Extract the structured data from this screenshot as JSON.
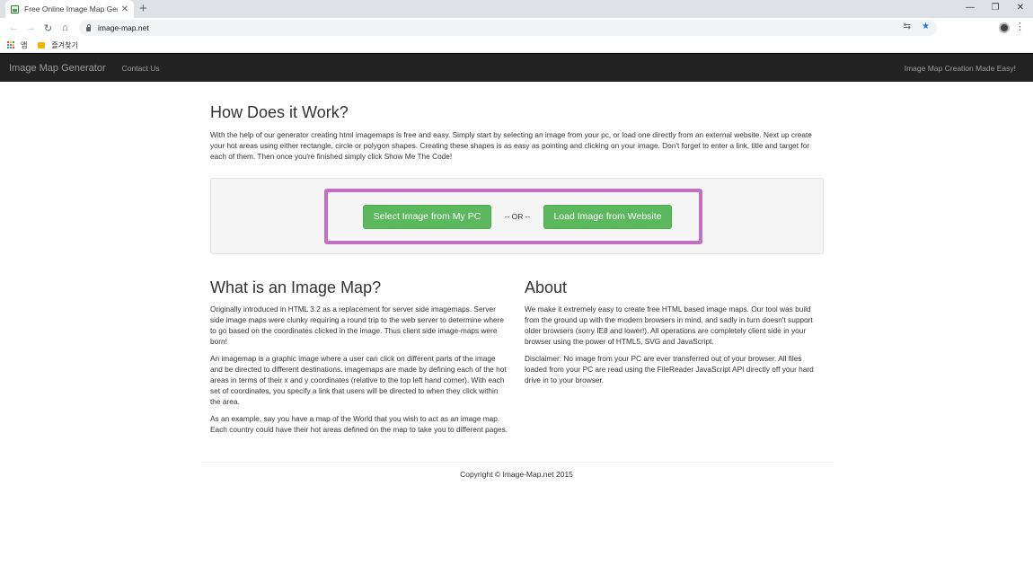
{
  "browser": {
    "tab_title": "Free Online Image Map Genera",
    "tab_close": "✕",
    "new_tab": "+",
    "url": "image-map.net",
    "bookmarks": {
      "apps_label": "앱",
      "folder_label": "즐겨찾기"
    }
  },
  "navbar": {
    "brand": "Image Map Generator",
    "contact": "Contact Us",
    "tagline": "Image Map Creation Made Easy!"
  },
  "how": {
    "heading": "How Does it Work?",
    "text": "With the help of our generator creating html imagemaps is free and easy. Simply start by selecting an image from your pc, or load one directly from an external website. Next up create your hot areas using either rectangle, circle or polygon shapes. Creating these shapes is as easy as pointing and clicking on your image. Don't forget to enter a link, title and target for each of them. Then once you're finished simply click Show Me The Code!"
  },
  "actions": {
    "select_pc": "Select Image from My PC",
    "or": "-- OR --",
    "load_web": "Load Image from Website"
  },
  "what": {
    "heading": "What is an Image Map?",
    "p1": "Originally introduced in HTML 3.2 as a replacement for server side imagemaps. Server side image maps were clunky requiring a round trip to the web server to determine where to go based on the coordinates clicked in the image. Thus client side image-maps were born!",
    "p2": "An imagemap is a graphic image where a user can click on different parts of the image and be directed to different destinations. imagemaps are made by defining each of the hot areas in terms of their x and y coordinates (relative to the top left hand corner). With each set of coordinates, you specify a link that users will be directed to when they click within the area.",
    "p3": "As an example, say you have a map of the World that you wish to act as an image map. Each country could have their hot areas defined on the map to take you to different pages."
  },
  "about": {
    "heading": "About",
    "p1": "We make it extremely easy to create free HTML based image maps. Our tool was build from the ground up with the modern browsers in mind, and sadly in turn doesn't support older browsers (sorry IE8 and lower!). All operations are completely client side in your browser using the power of HTML5, SVG and JavaScript.",
    "p2": "Disclaimer: No image from your PC are ever transferred out of your browser. All files loaded from your PC are read using the FileReader JavaScript API directly off your hard drive in to your browser."
  },
  "footer": {
    "copyright": "Copyright © Image-Map.net 2015"
  },
  "colors": {
    "navbar_bg": "#222222",
    "button_green": "#5cb85c",
    "highlight_border": "#c06fc5",
    "well_bg": "#f5f5f5"
  }
}
